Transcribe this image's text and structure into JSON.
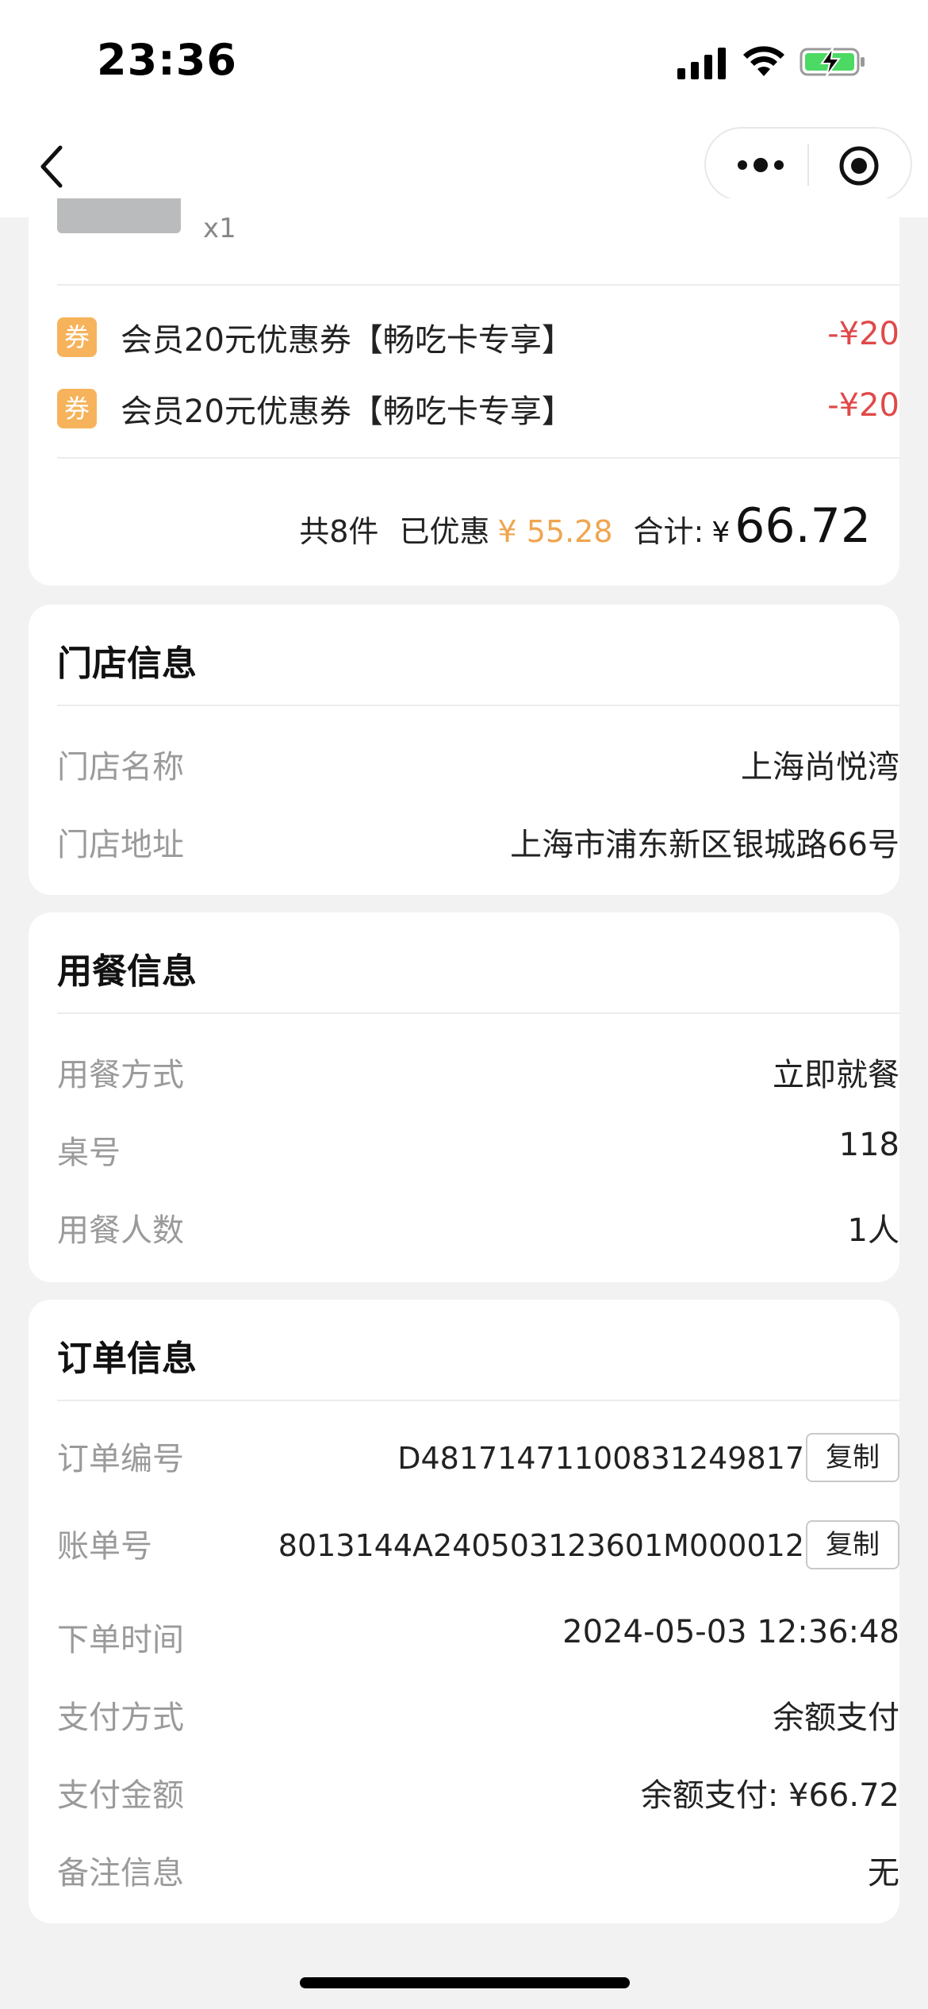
{
  "status_bar": {
    "time": "23:36"
  },
  "order_items": {
    "last_item_qty": "x1"
  },
  "coupons": [
    {
      "badge": "券",
      "name": "会员20元优惠券【畅吃卡专享】",
      "amount": "-¥20"
    },
    {
      "badge": "券",
      "name": "会员20元优惠券【畅吃卡专享】",
      "amount": "-¥20"
    }
  ],
  "summary": {
    "count": "共8件",
    "discount_label": "已优惠",
    "discount_value": "¥ 55.28",
    "total_label": "合计:",
    "currency": "¥",
    "total": "66.72"
  },
  "store_info": {
    "title": "门店信息",
    "rows": [
      {
        "label": "门店名称",
        "value": "上海尚悦湾"
      },
      {
        "label": "门店地址",
        "value": "上海市浦东新区银城路66号"
      }
    ]
  },
  "dining_info": {
    "title": "用餐信息",
    "rows": [
      {
        "label": "用餐方式",
        "value": "立即就餐"
      },
      {
        "label": "桌号",
        "value": "118"
      },
      {
        "label": "用餐人数",
        "value": "1人"
      }
    ]
  },
  "order_info": {
    "title": "订单信息",
    "copy_label": "复制",
    "rows": [
      {
        "label": "订单编号",
        "value": "D48171471100831249817"
      },
      {
        "label": "账单号",
        "value": "8013144A240503123601M000012"
      },
      {
        "label": "下单时间",
        "value": "2024-05-03 12:36:48"
      },
      {
        "label": "支付方式",
        "value": "余额支付"
      },
      {
        "label": "支付金额",
        "value": "余额支付: ¥66.72"
      },
      {
        "label": "备注信息",
        "value": "无"
      }
    ]
  },
  "colors": {
    "accent_orange": "#f0a550",
    "discount_red": "#e0494a",
    "coupon_badge": "#f6b35b"
  }
}
